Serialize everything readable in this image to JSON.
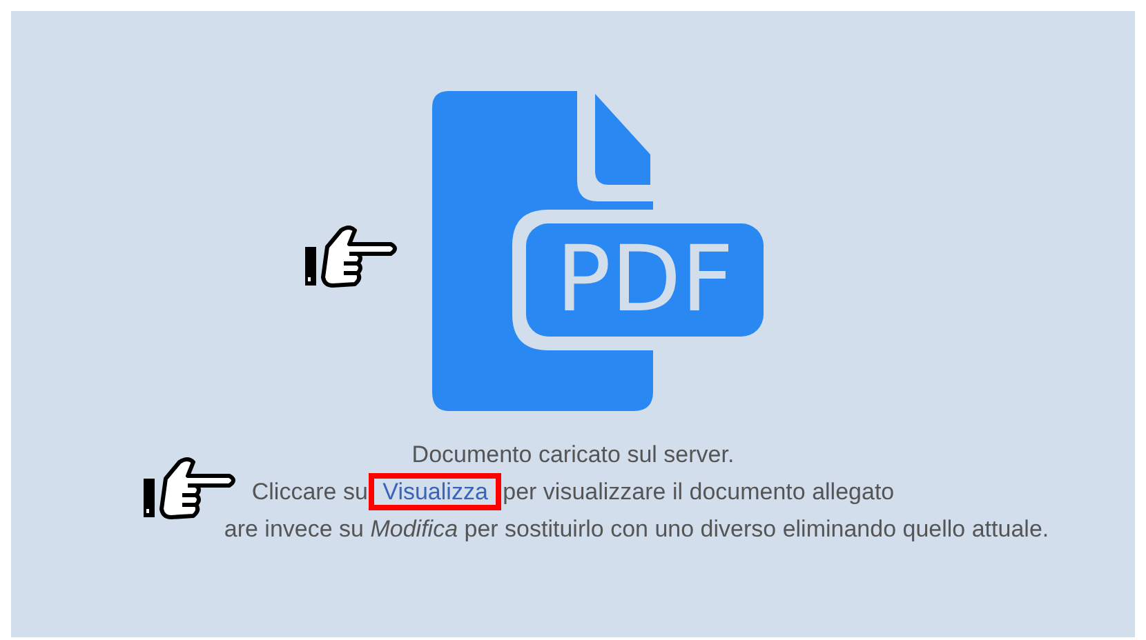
{
  "document": {
    "file_type": "PDF"
  },
  "message": {
    "lines": [
      {
        "kind": "plain",
        "text": "Documento caricato sul server."
      },
      {
        "kind": "link",
        "before": "Cliccare su",
        "link": {
          "text": "Visualizza",
          "highlighted": true
        },
        "after": "per visualizzare il documento allegato"
      },
      {
        "kind": "partial",
        "text": "are invece su *Modifica* per sostituirlo con uno diverso eliminando quello attuale."
      }
    ]
  }
}
